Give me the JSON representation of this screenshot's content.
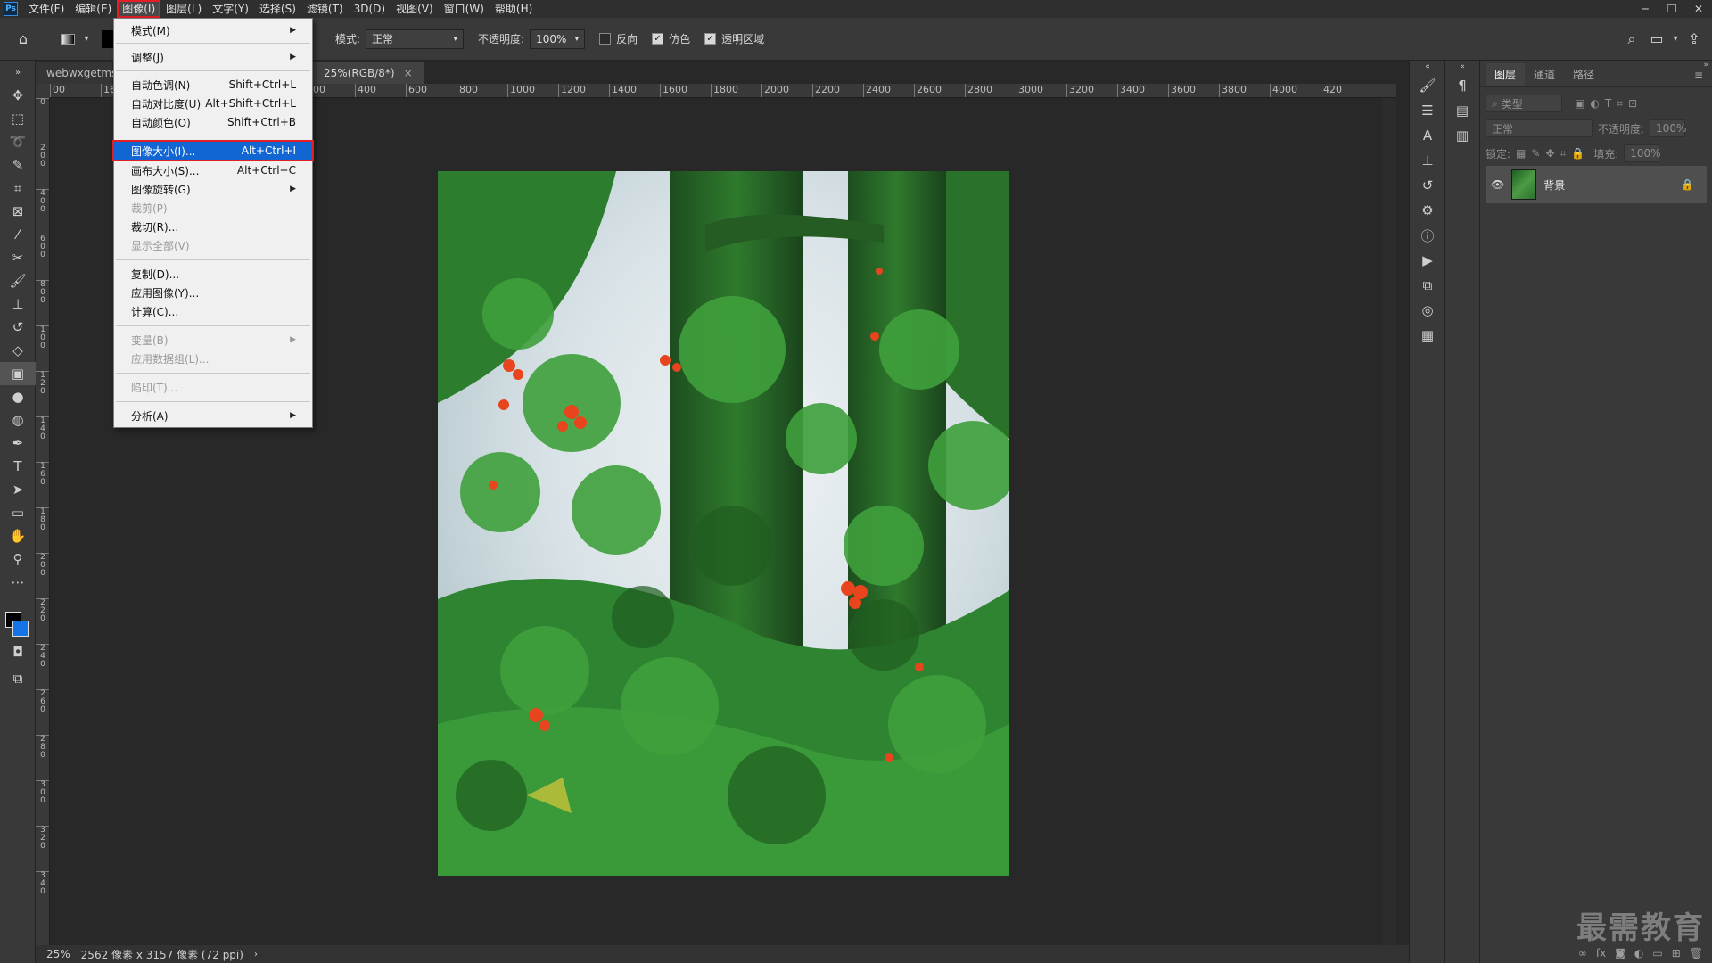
{
  "app": {
    "logo": "Ps"
  },
  "menubar": {
    "items": [
      "文件(F)",
      "编辑(E)",
      "图像(I)",
      "图层(L)",
      "文字(Y)",
      "选择(S)",
      "滤镜(T)",
      "3D(D)",
      "视图(V)",
      "窗口(W)",
      "帮助(H)"
    ],
    "active": "图像(I)"
  },
  "window_controls": {
    "minimize": "─",
    "restore": "❐",
    "close": "✕"
  },
  "options": {
    "mode_label": "模式:",
    "mode_value": "正常",
    "opacity_label": "不透明度:",
    "opacity_value": "100%",
    "reverse_label": "反向",
    "reverse_checked": false,
    "dither_label": "仿色",
    "dither_checked": true,
    "transparency_label": "透明区域",
    "transparency_checked": true
  },
  "tabs": [
    {
      "label": "webwxgetms",
      "active": false
    },
    {
      "label": "25%(RGB/8*)",
      "active": true,
      "close": "×"
    }
  ],
  "ruler": {
    "h_labels": [
      "00",
      "1600",
      "400",
      "200",
      "0",
      "200",
      "400",
      "600",
      "800",
      "1000",
      "1200",
      "1400",
      "1600",
      "1800",
      "2000",
      "2200",
      "2400",
      "2600",
      "2800",
      "3000",
      "3200",
      "3400",
      "3600",
      "3800",
      "4000",
      "420"
    ],
    "v_labels": [
      "0",
      "2 0 0",
      "4 0 0",
      "6 0 0",
      "8 0 0",
      "1 0 0",
      "1 2 0",
      "1 4 0",
      "1 6 0",
      "1 8 0",
      "2 0 0",
      "2 2 0",
      "2 4 0",
      "2 6 0",
      "2 8 0",
      "3 0 0",
      "3 2 0",
      "3 4 0"
    ]
  },
  "image_menu": {
    "items": [
      {
        "label": "模式(M)",
        "shortcut": "",
        "submenu": true,
        "disabled": false
      },
      {
        "label": "调整(J)",
        "shortcut": "",
        "submenu": true,
        "disabled": false
      },
      {
        "label": "自动色调(N)",
        "shortcut": "Shift+Ctrl+L",
        "submenu": false,
        "disabled": false
      },
      {
        "label": "自动对比度(U)",
        "shortcut": "Alt+Shift+Ctrl+L",
        "submenu": false,
        "disabled": false
      },
      {
        "label": "自动颜色(O)",
        "shortcut": "Shift+Ctrl+B",
        "submenu": false,
        "disabled": false
      },
      {
        "label": "图像大小(I)...",
        "shortcut": "Alt+Ctrl+I",
        "submenu": false,
        "disabled": false,
        "highlighted": true
      },
      {
        "label": "画布大小(S)...",
        "shortcut": "Alt+Ctrl+C",
        "submenu": false,
        "disabled": false
      },
      {
        "label": "图像旋转(G)",
        "shortcut": "",
        "submenu": true,
        "disabled": false
      },
      {
        "label": "裁剪(P)",
        "shortcut": "",
        "submenu": false,
        "disabled": true
      },
      {
        "label": "裁切(R)...",
        "shortcut": "",
        "submenu": false,
        "disabled": false
      },
      {
        "label": "显示全部(V)",
        "shortcut": "",
        "submenu": false,
        "disabled": true
      },
      {
        "label": "复制(D)...",
        "shortcut": "",
        "submenu": false,
        "disabled": false
      },
      {
        "label": "应用图像(Y)...",
        "shortcut": "",
        "submenu": false,
        "disabled": false
      },
      {
        "label": "计算(C)...",
        "shortcut": "",
        "submenu": false,
        "disabled": false
      },
      {
        "label": "变量(B)",
        "shortcut": "",
        "submenu": true,
        "disabled": true
      },
      {
        "label": "应用数据组(L)...",
        "shortcut": "",
        "submenu": false,
        "disabled": true
      },
      {
        "label": "陷印(T)...",
        "shortcut": "",
        "submenu": false,
        "disabled": true
      },
      {
        "label": "分析(A)",
        "shortcut": "",
        "submenu": true,
        "disabled": false
      }
    ]
  },
  "layers_panel": {
    "tabs": [
      "图层",
      "通道",
      "路径"
    ],
    "filter_placeholder": "类型",
    "blend_mode": "正常",
    "opacity_label": "不透明度:",
    "opacity_value": "100%",
    "lock_label": "锁定:",
    "fill_label": "填充:",
    "fill_value": "100%",
    "layers": [
      {
        "name": "背景",
        "visible": true,
        "locked": true
      }
    ]
  },
  "status": {
    "zoom": "25%",
    "doc_info": "2562 像素 x 3157 像素 (72 ppi)"
  },
  "watermark": "最需教育",
  "colors": {
    "accent": "#1266d4",
    "highlight_outline": "#e21f26",
    "foreground": "#000000",
    "background": "#1473e6"
  }
}
